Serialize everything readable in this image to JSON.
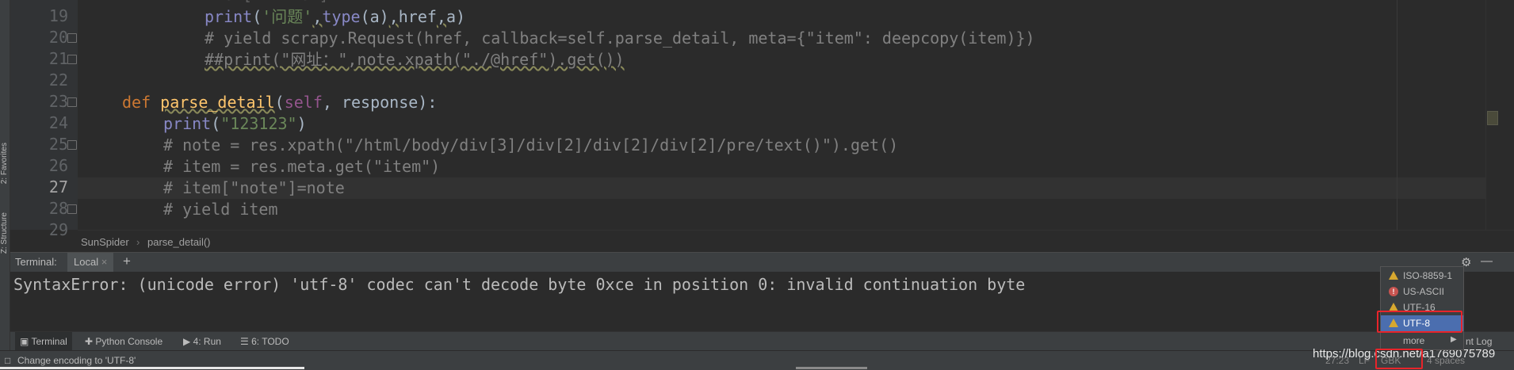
{
  "editor": {
    "lines": [
      {
        "num": "19",
        "indent": "        "
      },
      {
        "num": "20"
      },
      {
        "num": "21"
      },
      {
        "num": "22"
      },
      {
        "num": "23"
      },
      {
        "num": "24"
      },
      {
        "num": "25"
      },
      {
        "num": "26"
      },
      {
        "num": "27"
      },
      {
        "num": "28"
      },
      {
        "num": "29"
      }
    ],
    "code": {
      "l19_print": "print",
      "l19_open": "(",
      "l19_str": "'问题'",
      "l19_c1": ",",
      "l19_type": "type",
      "l19_a": "(a)",
      "l19_c2": ",",
      "l19_href": "href",
      "l19_c3": ",",
      "l19_tail": "a)",
      "l20": "# yield scrapy.Request(href, callback=self.parse_detail, meta={\"item\": deepcopy(item)})",
      "l21": "##print(\"网址：\",note.xpath(\"./@href\").get())",
      "l23_def": "def ",
      "l23_name": "parse_detail",
      "l23_open": "(",
      "l23_self": "self",
      "l23_rest": ", response):",
      "l24_print": "print",
      "l24_open": "(",
      "l24_str": "\"123123\"",
      "l24_close": ")",
      "l25": "# note = res.xpath(\"/html/body/div[3]/div[2]/div[2]/div[2]/pre/text()\").get()",
      "l26": "# item = res.meta.get(\"item\")",
      "l27": "# item[\"note\"]=note",
      "l28": "# yield item"
    }
  },
  "left_strip": {
    "favorites": "2: Favorites",
    "structure": "Z: Structure"
  },
  "breadcrumb": {
    "class_name": "SunSpider",
    "separator": "›",
    "method_name": "parse_detail()"
  },
  "terminal": {
    "label": "Terminal:",
    "tab": "Local",
    "tab_close": "×",
    "add": "+",
    "output": "SyntaxError: (unicode error) 'utf-8' codec can't decode byte 0xce in position 0: invalid continuation byte"
  },
  "tool_tabs": {
    "terminal": "Terminal",
    "python_console": "Python Console",
    "run": "4: Run",
    "todo": "6: TODO",
    "event_log": "nt Log"
  },
  "encoding_popup": {
    "items": [
      {
        "label": "ISO-8859-1",
        "status": "warning"
      },
      {
        "label": "US-ASCII",
        "status": "error"
      },
      {
        "label": "UTF-16",
        "status": "warning"
      },
      {
        "label": "UTF-8",
        "status": "warning",
        "selected": true
      }
    ],
    "more": "more"
  },
  "status_bar": {
    "message": "Change encoding to 'UTF-8'",
    "position": "27:23",
    "line_sep": "LF",
    "encoding": "GBK",
    "indent": "4 spaces"
  },
  "watermark": "https://blog.csdn.net/a1769075789",
  "colors": {
    "keyword": "#cc7832",
    "function": "#ffc66d",
    "string": "#6a8759",
    "comment": "#808080",
    "selection": "#4b6eaf",
    "highlight_box": "#e8242a"
  }
}
